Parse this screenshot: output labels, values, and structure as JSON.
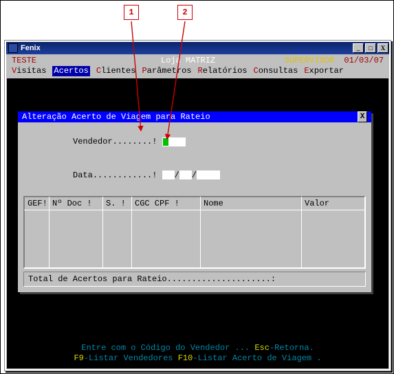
{
  "callouts": {
    "c1": "1",
    "c2": "2"
  },
  "window": {
    "title": "Fenix",
    "icon_label": "FENIX"
  },
  "header": {
    "env": "TESTE",
    "loja": "Loja MATRIZ",
    "role": "SUPERVISOR",
    "date": "01/03/07",
    "menu": [
      {
        "hot": "V",
        "rest": "isitas"
      },
      {
        "hot": "A",
        "rest": "certos"
      },
      {
        "hot": "C",
        "rest": "lientes"
      },
      {
        "hot": "P",
        "rest": "arâmetros"
      },
      {
        "hot": "R",
        "rest": "elatórios"
      },
      {
        "hot": "C",
        "rest": "onsultas"
      },
      {
        "hot": "E",
        "rest": "xportar"
      }
    ],
    "active_index": 1
  },
  "panel": {
    "title": "Alteração Acerto de Viagem para Rateio",
    "field_vend_label": "Vendedor........!",
    "field_data_label": "Data............!",
    "date_value": {
      "d": "",
      "m": "",
      "y": ""
    },
    "slash": "/",
    "columns": [
      "GEF!",
      "Nº Doc !",
      "S. !",
      "CGC CPF !",
      "Nome",
      "Valor"
    ],
    "total_label": "Total de Acertos para Rateio.....................:"
  },
  "help": {
    "line1_pre": "Entre com o Código do Vendedor ...  ",
    "line1_esc_hot": "Esc",
    "line1_esc_rest": "-Retorna.",
    "line2_f9_hot": "F9",
    "line2_f9_rest": "-Listar Vendedores  ",
    "line2_f10_hot": "F10",
    "line2_f10_rest": "-Listar  Acerto de Viagem ."
  }
}
